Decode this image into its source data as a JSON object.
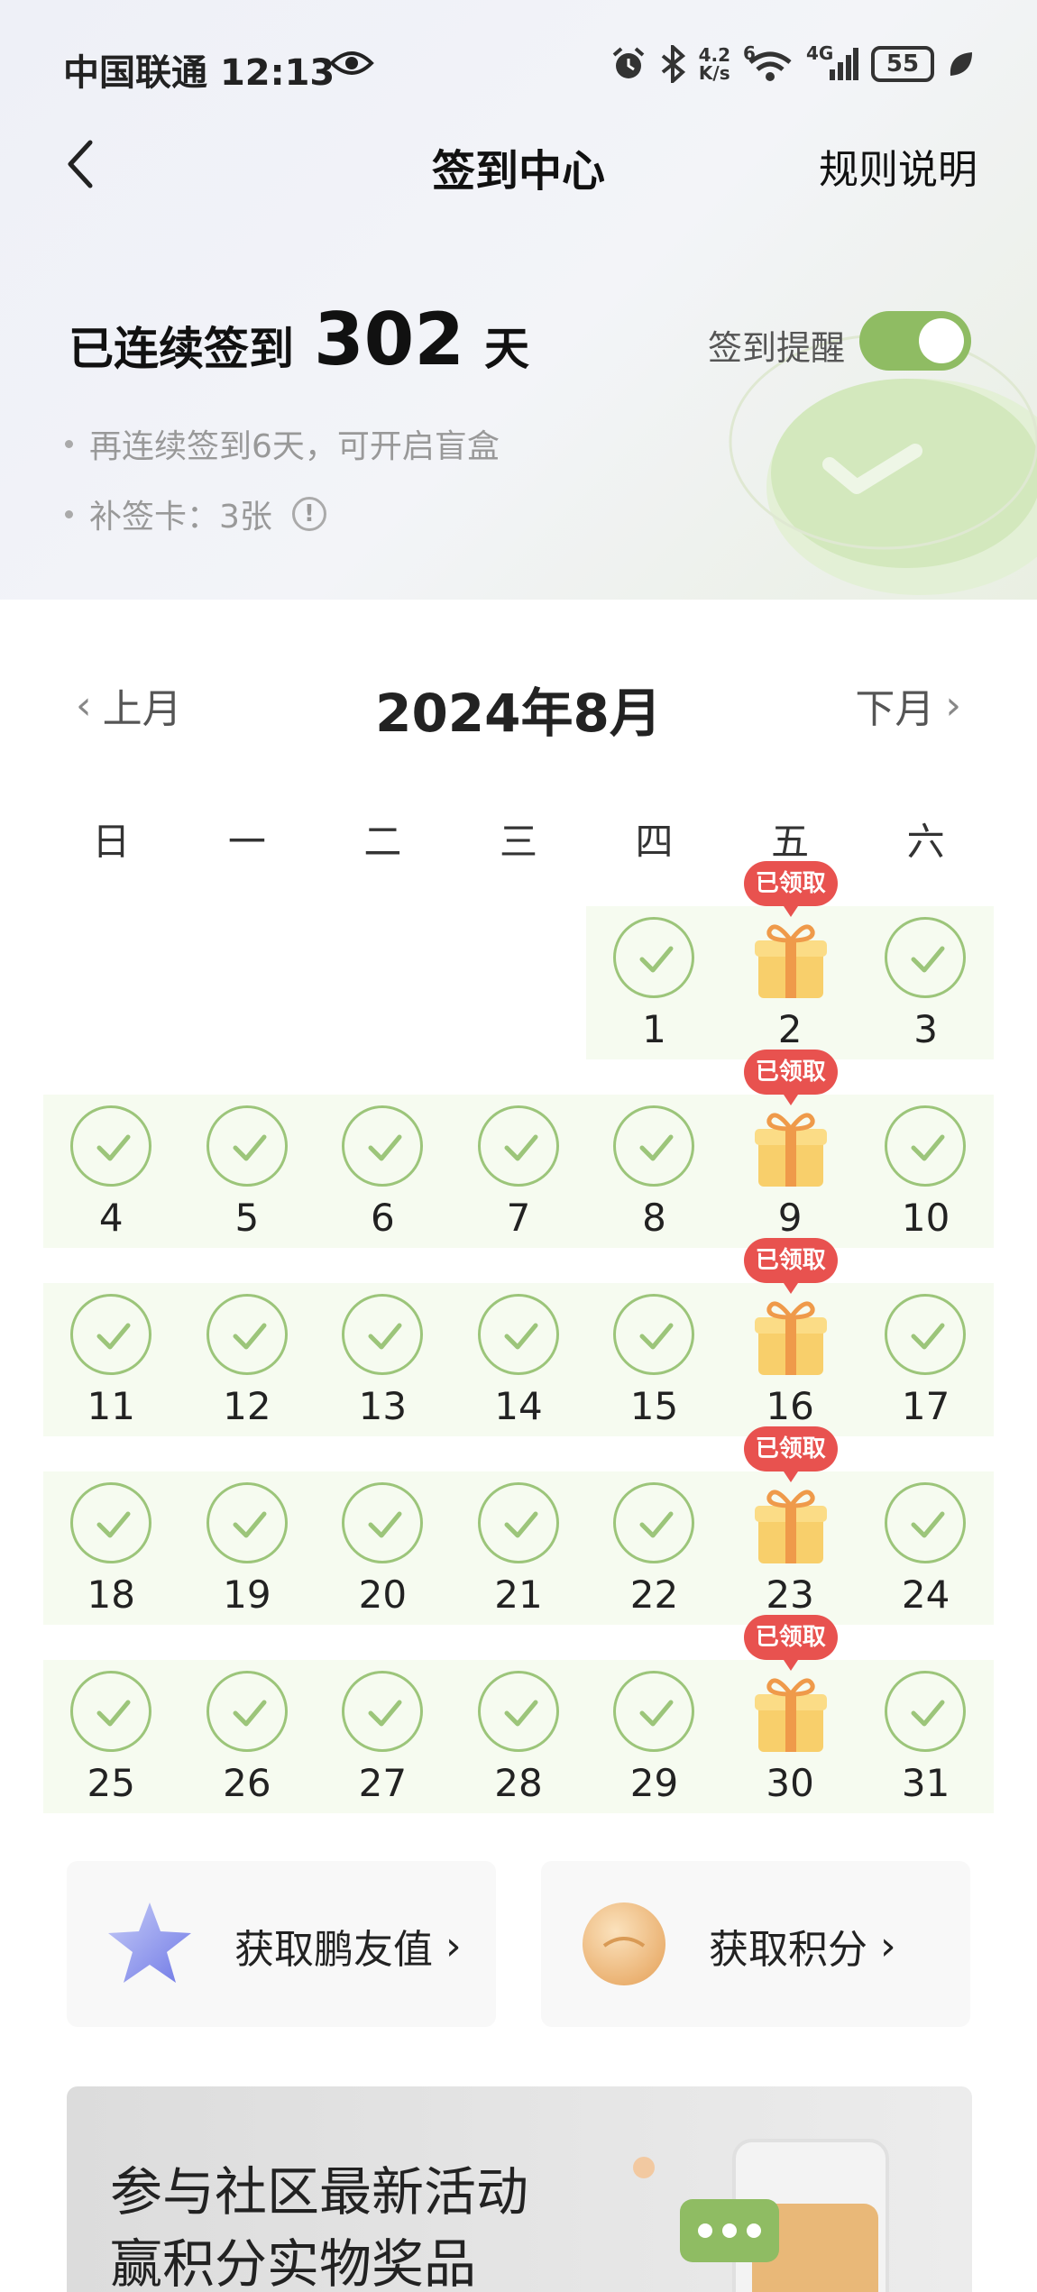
{
  "status_bar": {
    "carrier": "中国联通",
    "time": "12:13",
    "net_speed_value": "4.2",
    "net_speed_unit": "K/s",
    "signal_label": "4G",
    "wifi_label": "6",
    "battery": "55"
  },
  "nav": {
    "title": "签到中心",
    "rules": "规则说明"
  },
  "streak": {
    "prefix": "已连续签到",
    "days": "302",
    "suffix": "天"
  },
  "reminder": {
    "label": "签到提醒",
    "enabled": true
  },
  "tips": {
    "blind_box": "再连续签到6天，可开启盲盒",
    "makeup_cards": "补签卡：3张"
  },
  "month_nav": {
    "prev": "上月",
    "title": "2024年8月",
    "next": "下月"
  },
  "weekdays": [
    "日",
    "一",
    "二",
    "三",
    "四",
    "五",
    "六"
  ],
  "claimed_label": "已领取",
  "calendar": {
    "first_weekday_index": 4,
    "days_in_month": 31,
    "gift_days": [
      2,
      9,
      16,
      23,
      30
    ],
    "checked_days": [
      1,
      3,
      4,
      5,
      6,
      7,
      8,
      10,
      11,
      12,
      13,
      14,
      15,
      17,
      18,
      19,
      20,
      21,
      22,
      24,
      25,
      26,
      27,
      28,
      29,
      31
    ]
  },
  "cards": {
    "friend_value": "获取鹏友值",
    "points": "获取积分"
  },
  "banner": {
    "line1": "参与社区最新活动",
    "line2": "赢积分实物奖品"
  },
  "colors": {
    "accent_green": "#8fbc63",
    "badge_red": "#e8524f",
    "row_bg": "#f6fbf0"
  }
}
